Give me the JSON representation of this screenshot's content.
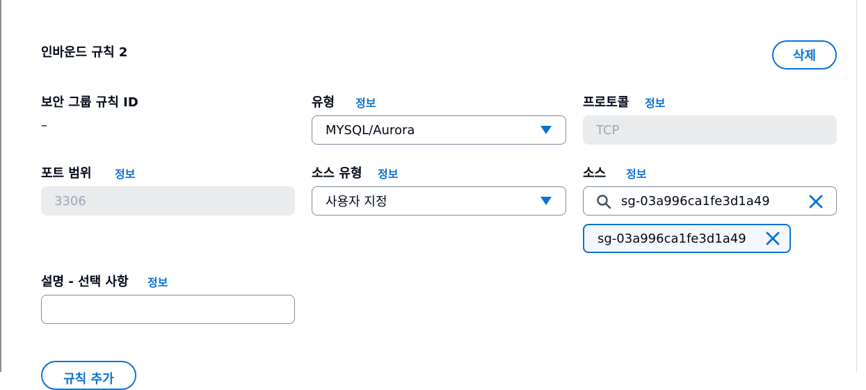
{
  "rule": {
    "title": "인바운드 규칙 2",
    "delete_label": "삭제",
    "info_label": "정보",
    "security_group_rule_id": {
      "label": "보안 그룹 규칙 ID",
      "value": "–"
    },
    "type": {
      "label": "유형",
      "value": "MYSQL/Aurora"
    },
    "protocol": {
      "label": "프로토콜",
      "value": "TCP"
    },
    "port_range": {
      "label": "포트 범위",
      "value": "3306"
    },
    "source_type": {
      "label": "소스 유형",
      "value": "사용자 지정"
    },
    "source": {
      "label": "소스",
      "search_value": "sg-03a996ca1fe3d1a49",
      "tokens": [
        "sg-03a996ca1fe3d1a49"
      ]
    },
    "description": {
      "label": "설명 - 선택 사항",
      "value": ""
    }
  },
  "add_rule_label": "규칙 추가",
  "colors": {
    "accent": "#0972d3",
    "disabled_bg": "#e9ebed",
    "border": "#7d8998"
  }
}
